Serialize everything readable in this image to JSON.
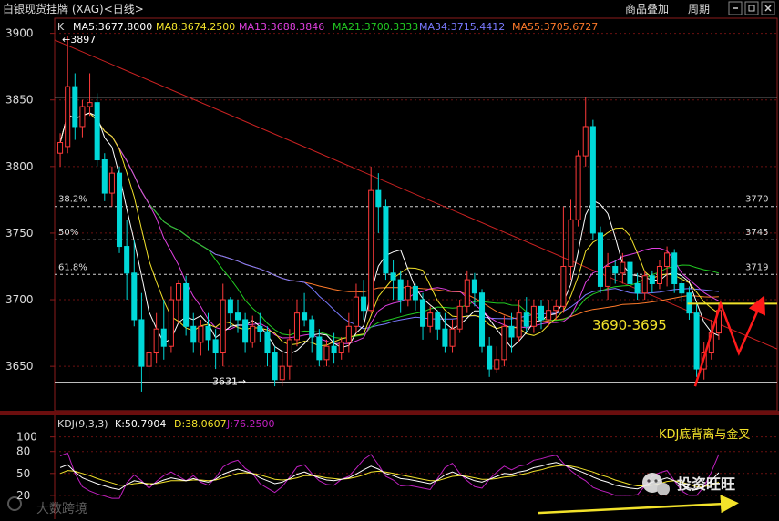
{
  "window": {
    "title": "白银现货挂牌 (XAG)<日线>",
    "buttons": [
      "商品叠加",
      "周期"
    ]
  },
  "colors": {
    "up": "#ff3a3a",
    "down": "#00d8d8",
    "ma5": "#ffffff",
    "ma8": "#f2e22a",
    "ma13": "#e040e0",
    "ma21": "#22cc22",
    "ma34": "#7a7aff",
    "ma55": "#ff7a2a",
    "k_line": "#ffffff",
    "d_line": "#f2e22a",
    "j_line": "#c020c0",
    "annotation": "#f2e22a",
    "arrow": "#ff1a1a",
    "trendline": "#cc2222"
  },
  "chart_data": [
    {
      "type": "candlestick",
      "ylim": [
        3620,
        3910
      ],
      "y_ticks": [
        3650,
        3700,
        3750,
        3800,
        3850,
        3900
      ],
      "legend": {
        "k_label": "K",
        "ma5": "MA5:3677.8000",
        "ma8": "MA8:3674.2500",
        "ma13": "MA13:3688.3846",
        "ma21": "MA21:3700.3333",
        "ma34": "MA34:3715.4412",
        "ma55": "MA55:3705.6727"
      },
      "annotations": {
        "high_label": "←3897",
        "low_label": "3631→",
        "support_zone": "3690-3695"
      },
      "fibonacci": [
        {
          "label": "38.2%",
          "value": 3770,
          "right_label": "3770"
        },
        {
          "label": "50%",
          "value": 3745,
          "right_label": "3745"
        },
        {
          "label": "61.8%",
          "value": 3719,
          "right_label": "3719"
        }
      ],
      "reference_lines": {
        "top": 3852,
        "bottom": 3638,
        "support": 3697
      },
      "trendline": [
        {
          "x": 0,
          "y": 3895
        },
        {
          "x": 87,
          "y": 3663
        }
      ],
      "candles": [
        [
          3810,
          3818,
          3800,
          3825
        ],
        [
          3815,
          3860,
          3810,
          3898
        ],
        [
          3860,
          3830,
          3820,
          3870
        ],
        [
          3830,
          3845,
          3822,
          3850
        ],
        [
          3845,
          3848,
          3838,
          3870
        ],
        [
          3848,
          3805,
          3800,
          3855
        ],
        [
          3805,
          3780,
          3774,
          3810
        ],
        [
          3780,
          3795,
          3770,
          3800
        ],
        [
          3795,
          3740,
          3735,
          3800
        ],
        [
          3740,
          3720,
          3700,
          3760
        ],
        [
          3720,
          3685,
          3680,
          3745
        ],
        [
          3685,
          3650,
          3631,
          3705
        ],
        [
          3650,
          3660,
          3640,
          3680
        ],
        [
          3660,
          3678,
          3652,
          3690
        ],
        [
          3678,
          3665,
          3655,
          3700
        ],
        [
          3665,
          3700,
          3660,
          3710
        ],
        [
          3700,
          3712,
          3682,
          3715
        ],
        [
          3712,
          3680,
          3673,
          3718
        ],
        [
          3680,
          3668,
          3660,
          3690
        ],
        [
          3668,
          3680,
          3658,
          3685
        ],
        [
          3680,
          3670,
          3662,
          3690
        ],
        [
          3670,
          3660,
          3648,
          3678
        ],
        [
          3660,
          3700,
          3650,
          3712
        ],
        [
          3700,
          3690,
          3680,
          3702
        ],
        [
          3690,
          3685,
          3675,
          3700
        ],
        [
          3685,
          3668,
          3660,
          3690
        ],
        [
          3668,
          3680,
          3664,
          3688
        ],
        [
          3680,
          3676,
          3668,
          3690
        ],
        [
          3676,
          3660,
          3650,
          3680
        ],
        [
          3660,
          3640,
          3635,
          3665
        ],
        [
          3640,
          3650,
          3635,
          3660
        ],
        [
          3650,
          3670,
          3640,
          3678
        ],
        [
          3670,
          3690,
          3665,
          3700
        ],
        [
          3690,
          3685,
          3680,
          3705
        ],
        [
          3685,
          3672,
          3660,
          3688
        ],
        [
          3672,
          3655,
          3650,
          3678
        ],
        [
          3655,
          3665,
          3650,
          3670
        ],
        [
          3665,
          3660,
          3652,
          3675
        ],
        [
          3660,
          3668,
          3655,
          3672
        ],
        [
          3668,
          3680,
          3660,
          3690
        ],
        [
          3680,
          3702,
          3675,
          3712
        ],
        [
          3702,
          3692,
          3685,
          3715
        ],
        [
          3692,
          3782,
          3690,
          3800
        ],
        [
          3782,
          3770,
          3750,
          3795
        ],
        [
          3770,
          3720,
          3715,
          3775
        ],
        [
          3720,
          3715,
          3700,
          3730
        ],
        [
          3715,
          3700,
          3690,
          3722
        ],
        [
          3700,
          3710,
          3695,
          3715
        ],
        [
          3710,
          3700,
          3692,
          3712
        ],
        [
          3700,
          3680,
          3670,
          3705
        ],
        [
          3680,
          3690,
          3675,
          3695
        ],
        [
          3690,
          3678,
          3670,
          3692
        ],
        [
          3678,
          3665,
          3660,
          3690
        ],
        [
          3665,
          3678,
          3660,
          3685
        ],
        [
          3678,
          3695,
          3675,
          3700
        ],
        [
          3695,
          3715,
          3690,
          3722
        ],
        [
          3715,
          3705,
          3695,
          3720
        ],
        [
          3705,
          3665,
          3660,
          3708
        ],
        [
          3665,
          3648,
          3642,
          3672
        ],
        [
          3648,
          3655,
          3645,
          3665
        ],
        [
          3655,
          3680,
          3650,
          3688
        ],
        [
          3680,
          3672,
          3660,
          3690
        ],
        [
          3672,
          3690,
          3668,
          3700
        ],
        [
          3690,
          3680,
          3676,
          3702
        ],
        [
          3680,
          3695,
          3675,
          3700
        ],
        [
          3695,
          3685,
          3678,
          3700
        ],
        [
          3685,
          3692,
          3680,
          3700
        ],
        [
          3692,
          3695,
          3685,
          3700
        ],
        [
          3695,
          3725,
          3690,
          3770
        ],
        [
          3725,
          3760,
          3715,
          3775
        ],
        [
          3760,
          3808,
          3755,
          3812
        ],
        [
          3808,
          3830,
          3800,
          3852
        ],
        [
          3830,
          3750,
          3745,
          3835
        ],
        [
          3750,
          3710,
          3705,
          3755
        ],
        [
          3710,
          3725,
          3700,
          3735
        ],
        [
          3725,
          3720,
          3712,
          3730
        ],
        [
          3720,
          3728,
          3712,
          3735
        ],
        [
          3728,
          3712,
          3705,
          3732
        ],
        [
          3712,
          3705,
          3700,
          3720
        ],
        [
          3705,
          3718,
          3700,
          3722
        ],
        [
          3718,
          3712,
          3705,
          3722
        ],
        [
          3712,
          3725,
          3708,
          3730
        ],
        [
          3725,
          3735,
          3710,
          3740
        ],
        [
          3735,
          3712,
          3705,
          3738
        ],
        [
          3712,
          3705,
          3698,
          3718
        ],
        [
          3705,
          3690,
          3685,
          3710
        ],
        [
          3690,
          3648,
          3642,
          3698
        ],
        [
          3648,
          3660,
          3640,
          3668
        ],
        [
          3660,
          3675,
          3655,
          3685
        ],
        [
          3675,
          3692,
          3670,
          3698
        ]
      ]
    },
    {
      "type": "line",
      "legend": {
        "name": "KDJ(9,3,3)",
        "k": "K:50.7904",
        "d": "D:38.0607",
        "j": "J:76.2500"
      },
      "y_ticks": [
        20,
        50,
        80,
        100
      ],
      "ylim": [
        -10,
        112
      ],
      "annotation": "KDJ底背离与金叉",
      "k": [
        58,
        62,
        52,
        44,
        40,
        36,
        33,
        30,
        28,
        35,
        40,
        38,
        34,
        37,
        41,
        44,
        42,
        40,
        43,
        40,
        38,
        42,
        49,
        53,
        56,
        53,
        50,
        44,
        40,
        36,
        38,
        43,
        49,
        52,
        48,
        44,
        41,
        40,
        42,
        44,
        49,
        55,
        60,
        56,
        50,
        47,
        43,
        42,
        40,
        38,
        36,
        41,
        48,
        52,
        48,
        44,
        40,
        38,
        42,
        46,
        50,
        49,
        52,
        54,
        58,
        60,
        63,
        65,
        62,
        58,
        54,
        50,
        45,
        41,
        38,
        34,
        32,
        30,
        29,
        33,
        38,
        41,
        44,
        40,
        34,
        30,
        28,
        32,
        40,
        51
      ],
      "d": [
        50,
        54,
        53,
        50,
        47,
        43,
        40,
        37,
        34,
        34,
        36,
        37,
        36,
        36,
        38,
        40,
        40,
        40,
        41,
        41,
        40,
        41,
        44,
        47,
        50,
        51,
        50,
        48,
        45,
        42,
        41,
        42,
        44,
        47,
        47,
        46,
        44,
        43,
        42,
        43,
        45,
        48,
        52,
        53,
        52,
        50,
        48,
        46,
        44,
        42,
        40,
        40,
        43,
        46,
        47,
        46,
        44,
        42,
        42,
        43,
        45,
        46,
        48,
        50,
        53,
        55,
        58,
        60,
        61,
        60,
        58,
        55,
        52,
        48,
        45,
        41,
        38,
        35,
        33,
        33,
        34,
        36,
        39,
        40,
        38,
        35,
        32,
        32,
        34,
        38
      ],
      "j": [
        74,
        78,
        50,
        32,
        26,
        22,
        19,
        16,
        16,
        37,
        48,
        40,
        30,
        39,
        47,
        52,
        46,
        40,
        47,
        38,
        34,
        44,
        59,
        65,
        68,
        57,
        50,
        36,
        30,
        24,
        32,
        45,
        59,
        62,
        50,
        40,
        35,
        34,
        42,
        46,
        57,
        69,
        76,
        62,
        46,
        41,
        33,
        34,
        32,
        30,
        28,
        43,
        58,
        64,
        50,
        40,
        32,
        30,
        42,
        52,
        60,
        55,
        60,
        62,
        68,
        70,
        73,
        75,
        64,
        54,
        46,
        40,
        31,
        27,
        24,
        20,
        20,
        20,
        21,
        33,
        46,
        51,
        54,
        40,
        26,
        20,
        20,
        32,
        52,
        76
      ]
    }
  ],
  "watermarks": {
    "right": "投资旺旺",
    "left": "大数跨境"
  }
}
